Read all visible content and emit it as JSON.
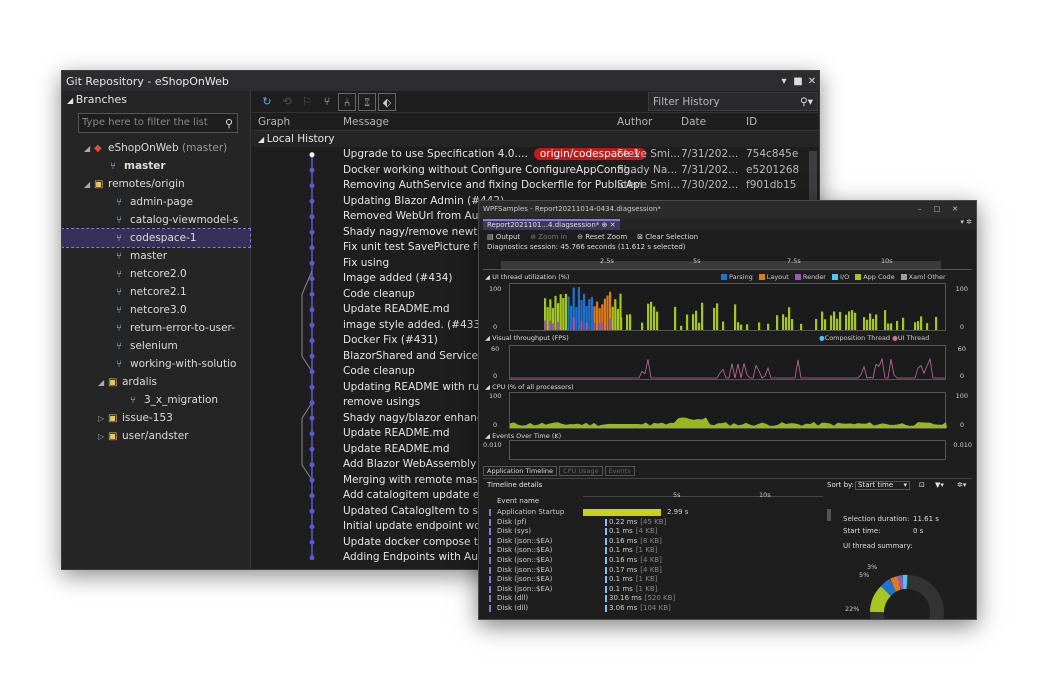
{
  "git": {
    "title": "Git Repository - eShopOnWeb",
    "branches_header": "Branches",
    "filter_placeholder": "Type here to filter the list",
    "filter_history_placeholder": "Filter History",
    "columns": {
      "graph": "Graph",
      "message": "Message",
      "author": "Author",
      "date": "Date",
      "id": "ID"
    },
    "local_history": "Local History",
    "repo": {
      "name": "eShopOnWeb",
      "suffix": "(master)"
    },
    "branches": [
      {
        "label": "master",
        "bold": true
      },
      {
        "label": "remotes/origin",
        "folder": true
      },
      {
        "label": "admin-page"
      },
      {
        "label": "catalog-viewmodel-s"
      },
      {
        "label": "codespace-1",
        "selected": true
      },
      {
        "label": "master"
      },
      {
        "label": "netcore2.0"
      },
      {
        "label": "netcore2.1"
      },
      {
        "label": "netcore3.0"
      },
      {
        "label": "return-error-to-user-"
      },
      {
        "label": "selenium"
      },
      {
        "label": "working-with-solutio"
      },
      {
        "label": "ardalis",
        "folder": true
      },
      {
        "label": "3_x_migration"
      },
      {
        "label": "issue-153",
        "folder": true
      },
      {
        "label": "user/andster",
        "folder": true
      }
    ],
    "commits": [
      {
        "msg": "Upgrade to use Specification 4.0....",
        "tag": "origin/codespace-1",
        "author": "Steve Smi...",
        "date": "7/31/202...",
        "id": "754c845e"
      },
      {
        "msg": "Docker working without Configure ConfigureAppConfig...",
        "author": "Shady Na...",
        "date": "7/31/202...",
        "id": "e5201268"
      },
      {
        "msg": "Removing AuthService and fixing Dockerfile for PublicApi",
        "author": "Steve Smi...",
        "date": "7/30/202...",
        "id": "f901db15"
      },
      {
        "msg": "Updating Blazor Admin (#442)"
      },
      {
        "msg": "Removed WebUrl from AuthS"
      },
      {
        "msg": "Shady nagy/remove newton s"
      },
      {
        "msg": "Fix unit test SavePicture funct"
      },
      {
        "msg": "Fix using"
      },
      {
        "msg": "Image added (#434)"
      },
      {
        "msg": "Code cleanup"
      },
      {
        "msg": "Update README.md"
      },
      {
        "msg": "image style added. (#433)"
      },
      {
        "msg": "Docker Fix (#431)"
      },
      {
        "msg": "BlazorShared and Services (#"
      },
      {
        "msg": "Code cleanup"
      },
      {
        "msg": "Updating README with runni"
      },
      {
        "msg": "remove usings"
      },
      {
        "msg": "Shady nagy/blazor enhance (#"
      },
      {
        "msg": "Update README.md"
      },
      {
        "msg": "Update README.md"
      },
      {
        "msg": "Add Blazor WebAssembly Adm"
      },
      {
        "msg": "Merging with remote master"
      },
      {
        "msg": "Add catalogitem update endp"
      },
      {
        "msg": "Updated CatalogItem to supp"
      },
      {
        "msg": "Initial update endpoint workin"
      },
      {
        "msg": "Update docker compose to in"
      },
      {
        "msg": "Adding Endpoints with Autho"
      }
    ]
  },
  "diag": {
    "title": "WPFSamples - Report20211014-0434.diagsession*",
    "tab": "Report2021101...4.diagsession*",
    "toolbar": {
      "output": "Output",
      "zoom_in": "Zoom in",
      "reset_zoom": "Reset Zoom",
      "clear_selection": "Clear Selection"
    },
    "session": "Diagnostics session: 45.766 seconds (11.612 s selected)",
    "ruler": [
      "2.5s",
      "5s",
      "7.5s",
      "10s"
    ],
    "lanes": {
      "ui_thread": "UI thread utilization (%)",
      "visual": "Visual throughput (FPS)",
      "cpu": "CPU (% of all processors)",
      "events": "Events Over Time (K)"
    },
    "legend_ui": [
      {
        "name": "Parsing",
        "color": "#1e73d2"
      },
      {
        "name": "Layout",
        "color": "#e07b18"
      },
      {
        "name": "Render",
        "color": "#9b59b6"
      },
      {
        "name": "I/O",
        "color": "#4fc3f7"
      },
      {
        "name": "App Code",
        "color": "#a6c81e"
      },
      {
        "name": "Xaml Other",
        "color": "#9e9e9e"
      }
    ],
    "legend_fps": [
      "Composition Thread",
      "UI Thread"
    ],
    "axis": {
      "ui_max": "100",
      "ui_min": "0",
      "fps_max": "60",
      "fps_min": "0",
      "cpu_max": "100",
      "cpu_min": "0",
      "ev_max": "0.010",
      "ev_min": "0.010"
    },
    "bottom_tabs": [
      "Application Timeline",
      "CPU Usage",
      "Events"
    ],
    "details": {
      "title": "Timeline details",
      "sort_by": "Sort by:",
      "sort_value": "Start time",
      "event_name": "Event name",
      "ticks": [
        "5s",
        "10s"
      ],
      "events": [
        {
          "name": "Application Startup",
          "val": "2.99 s",
          "size": ""
        },
        {
          "name": "Disk (pf)",
          "val": "0.22 ms",
          "size": "[45 KB]"
        },
        {
          "name": "Disk (sys)",
          "val": "0.1 ms",
          "size": "[4 KB]"
        },
        {
          "name": "Disk (json::$EA)",
          "val": "0.16 ms",
          "size": "[8 KB]"
        },
        {
          "name": "Disk (json::$EA)",
          "val": "0.1 ms",
          "size": "[1 KB]"
        },
        {
          "name": "Disk (json::$EA)",
          "val": "0.16 ms",
          "size": "[4 KB]"
        },
        {
          "name": "Disk (json::$EA)",
          "val": "0.17 ms",
          "size": "[4 KB]"
        },
        {
          "name": "Disk (json::$EA)",
          "val": "0.1 ms",
          "size": "[1 KB]"
        },
        {
          "name": "Disk (json::$EA)",
          "val": "0.1 ms",
          "size": "[1 KB]"
        },
        {
          "name": "Disk (dll)",
          "val": "30.16 ms",
          "size": "[520 KB]"
        },
        {
          "name": "Disk (dll)",
          "val": "3.06 ms",
          "size": "[104 KB]"
        }
      ],
      "selection_duration_label": "Selection duration:",
      "selection_duration": "11.61 s",
      "start_time_label": "Start time:",
      "start_time": "0 s",
      "ui_summary": "UI thread summary:",
      "pct": [
        "3%",
        "5%",
        "22%"
      ]
    }
  }
}
